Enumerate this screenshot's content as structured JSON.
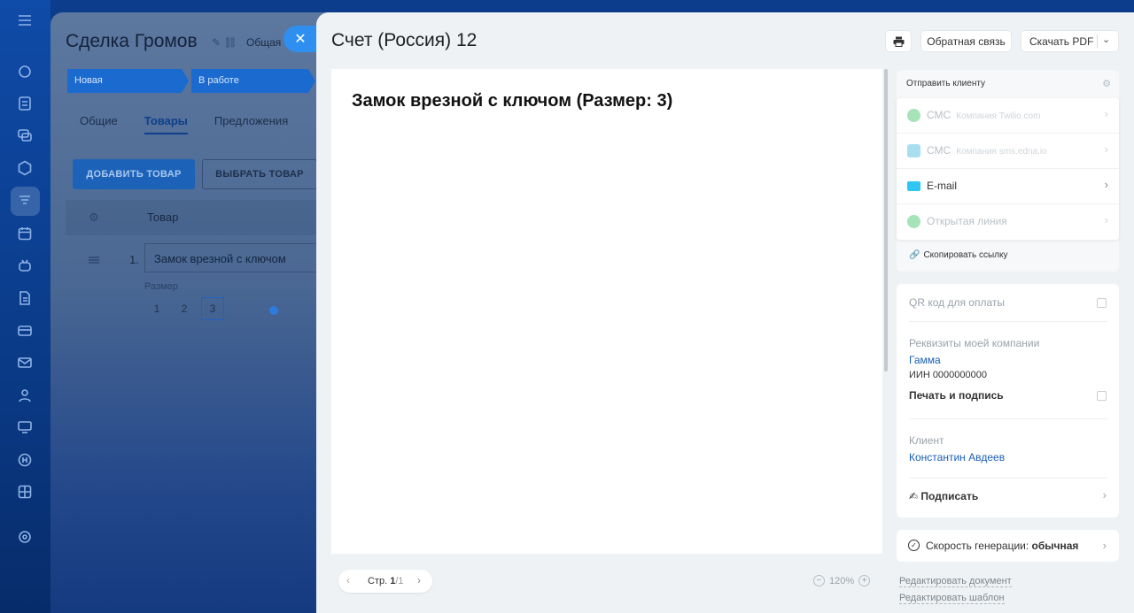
{
  "deal": {
    "title": "Сделка Громов",
    "category": "Общая",
    "stages": [
      "Новая",
      "В работе"
    ],
    "tabs": [
      "Общие",
      "Товары",
      "Предложения"
    ],
    "add_product": "ДОБАВИТЬ ТОВАР",
    "pick_product": "ВЫБРАТЬ ТОВАР",
    "product_column": "Товар",
    "row_number": "1.",
    "product_name": "Замок врезной с ключом",
    "size_label": "Размер",
    "sizes": [
      "1",
      "2",
      "3"
    ],
    "selected_size": "3"
  },
  "invoice": {
    "title": "Счет (Россия) 12",
    "feedback_label": "Обратная связь",
    "download_pdf_label": "Скачать PDF",
    "document_heading": "Замок врезной с ключом (Размер: 3)",
    "page_label": "Стр.",
    "page_current": "1",
    "page_total": "/1",
    "zoom": "120%"
  },
  "send": {
    "title": "Отправить клиенту",
    "items": [
      {
        "label": "СМС",
        "sub": "Компания Twilio.com",
        "enabled": false,
        "color": "#a6e3b9"
      },
      {
        "label": "СМС",
        "sub": "Компания sms.edna.io",
        "enabled": false,
        "color": "#a9def1"
      },
      {
        "label": "E-mail",
        "sub": "",
        "enabled": true,
        "color": "#2fc6f6"
      },
      {
        "label": "Открытая линия",
        "sub": "",
        "enabled": false,
        "color": "#a6e3b9"
      }
    ],
    "copy_link": "Скопировать ссылку"
  },
  "details": {
    "qr_label": "QR код для оплаты",
    "company_label": "Реквизиты моей компании",
    "company_name": "Гамма",
    "company_inn": "ИИН 0000000000",
    "print_sign_label": "Печать и подпись",
    "client_label": "Клиент",
    "client_name": "Константин Авдеев",
    "sign_label": "Подписать"
  },
  "speed": {
    "label": "Скорость генерации:",
    "value": "обычная"
  },
  "links": {
    "edit_document": "Редактировать документ",
    "edit_template": "Редактировать шаблон"
  }
}
